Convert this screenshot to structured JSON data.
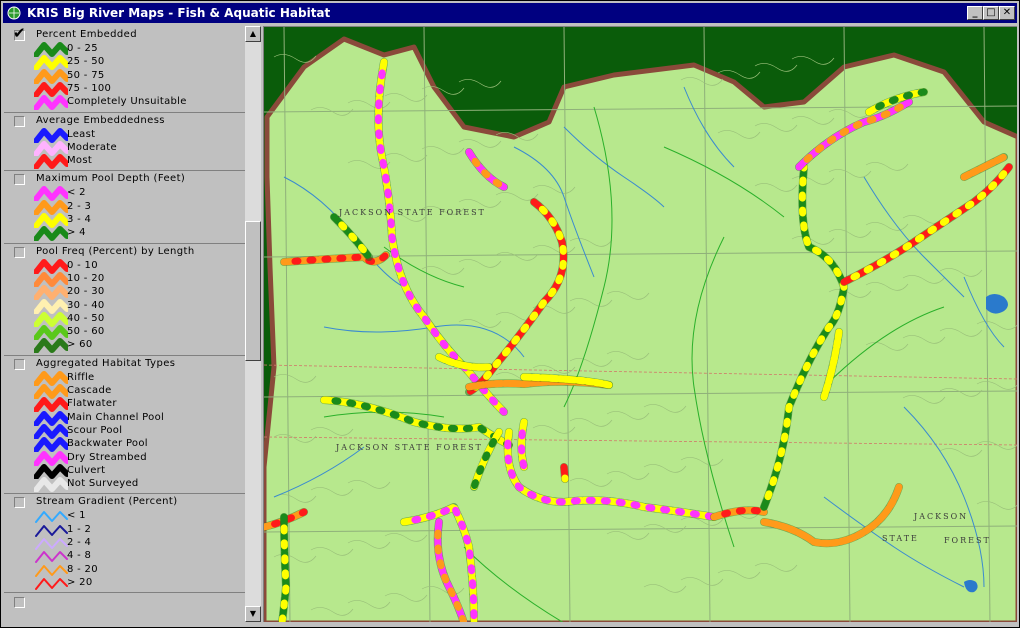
{
  "window": {
    "title": "KRIS Big River Maps - Fish & Aquatic Habitat",
    "minimize_glyph": "_",
    "maximize_glyph": "□",
    "close_glyph": "✕"
  },
  "legend": {
    "groups": [
      {
        "title": "Percent Embedded",
        "checked": true,
        "items": [
          {
            "label": "0 - 25",
            "color": "#1a8a1a"
          },
          {
            "label": "25 - 50",
            "color": "#ffff00"
          },
          {
            "label": "50 - 75",
            "color": "#ff9a1a"
          },
          {
            "label": "75 - 100",
            "color": "#ff1a1a"
          },
          {
            "label": "Completely Unsuitable",
            "color": "#ff33ff"
          }
        ]
      },
      {
        "title": "Average Embeddedness",
        "checked": false,
        "items": [
          {
            "label": "Least",
            "color": "#1a1aff"
          },
          {
            "label": "Moderate",
            "color": "#ffb3ff"
          },
          {
            "label": "Most",
            "color": "#ff1a1a"
          }
        ]
      },
      {
        "title": "Maximum Pool Depth (Feet)",
        "checked": false,
        "items": [
          {
            "label": "< 2",
            "color": "#ff33ff"
          },
          {
            "label": "2 - 3",
            "color": "#ff9a1a"
          },
          {
            "label": "3 - 4",
            "color": "#ffff00"
          },
          {
            "label": "> 4",
            "color": "#1a8a1a"
          }
        ]
      },
      {
        "title": "Pool Freq (Percent) by Length",
        "checked": false,
        "items": [
          {
            "label": "0 - 10",
            "color": "#ff1a1a"
          },
          {
            "label": "10 - 20",
            "color": "#ff8a3a"
          },
          {
            "label": "20 - 30",
            "color": "#ffb070"
          },
          {
            "label": "30 - 40",
            "color": "#fff0b0"
          },
          {
            "label": "40 - 50",
            "color": "#ccff33"
          },
          {
            "label": "50 - 60",
            "color": "#5ac81a"
          },
          {
            "label": "> 60",
            "color": "#2a7a1a"
          }
        ]
      },
      {
        "title": "Aggregated Habitat Types",
        "checked": false,
        "items": [
          {
            "label": "Riffle",
            "color": "#ff9a1a"
          },
          {
            "label": "Cascade",
            "color": "#ff9a1a"
          },
          {
            "label": "Flatwater",
            "color": "#ff1a1a"
          },
          {
            "label": "Main Channel Pool",
            "color": "#1a1aff"
          },
          {
            "label": "Scour Pool",
            "color": "#1a1aff"
          },
          {
            "label": "Backwater Pool",
            "color": "#1a1aff"
          },
          {
            "label": "Dry Streambed",
            "color": "#ff33ff"
          },
          {
            "label": "Culvert",
            "color": "#000000"
          },
          {
            "label": "Not Surveyed",
            "color": "#e8e8e8"
          }
        ]
      },
      {
        "title": "Stream Gradient (Percent)",
        "checked": false,
        "items": [
          {
            "label": "< 1",
            "color": "#33aaff"
          },
          {
            "label": "1 - 2",
            "color": "#1a1a99"
          },
          {
            "label": "2 - 4",
            "color": "#ccaaff"
          },
          {
            "label": "4 - 8",
            "color": "#cc33cc"
          },
          {
            "label": "8 - 20",
            "color": "#ff9a1a"
          },
          {
            "label": "> 20",
            "color": "#ff1a1a"
          }
        ]
      }
    ]
  },
  "map": {
    "labels": [
      {
        "text": "JACKSON   STATE   FOREST"
      },
      {
        "text": "JACKSON   STATE   FOREST"
      },
      {
        "text": "JACKSON"
      },
      {
        "text": "STATE"
      },
      {
        "text": "FOREST"
      }
    ],
    "colors": {
      "land": "#b7e88d",
      "forest": "#0a5c0a",
      "boundary": "#8a4a3a",
      "stream": "#3a8ad0"
    }
  }
}
